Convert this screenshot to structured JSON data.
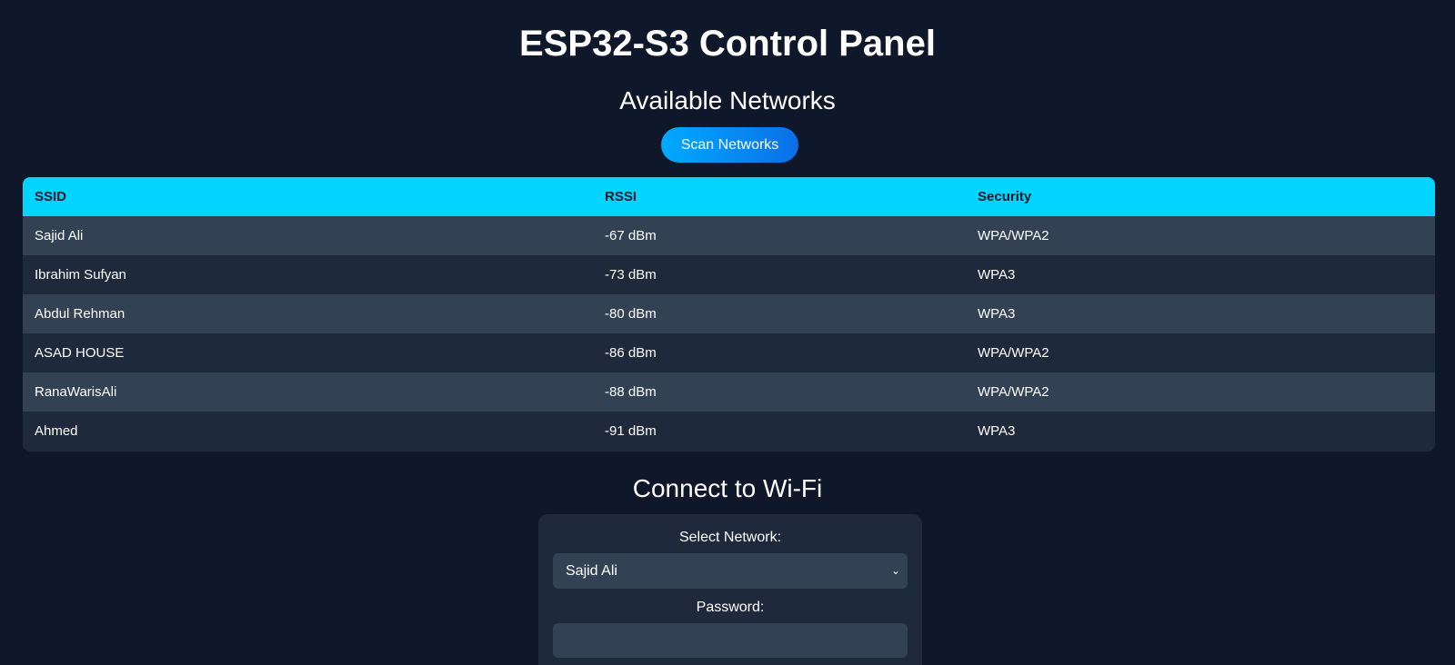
{
  "header": {
    "title": "ESP32-S3 Control Panel"
  },
  "networks": {
    "title": "Available Networks",
    "scan_label": "Scan Networks",
    "columns": [
      "SSID",
      "RSSI",
      "Security"
    ],
    "rows": [
      {
        "ssid": "Sajid Ali",
        "rssi": "-67 dBm",
        "security": "WPA/WPA2"
      },
      {
        "ssid": "Ibrahim Sufyan",
        "rssi": "-73 dBm",
        "security": "WPA3"
      },
      {
        "ssid": "Abdul Rehman",
        "rssi": "-80 dBm",
        "security": "WPA3"
      },
      {
        "ssid": "ASAD HOUSE",
        "rssi": "-86 dBm",
        "security": "WPA/WPA2"
      },
      {
        "ssid": "RanaWarisAli",
        "rssi": "-88 dBm",
        "security": "WPA/WPA2"
      },
      {
        "ssid": "Ahmed",
        "rssi": "-91 dBm",
        "security": "WPA3"
      }
    ]
  },
  "connect": {
    "title": "Connect to Wi-Fi",
    "select_label": "Select Network:",
    "selected_network": "Sajid Ali",
    "password_label": "Password:",
    "password_value": ""
  },
  "colors": {
    "background": "#0f172a",
    "table_header": "#00d4ff",
    "accent": "#0b6fe8"
  },
  "icons": {
    "select_chevron": "chevron-down-icon"
  }
}
